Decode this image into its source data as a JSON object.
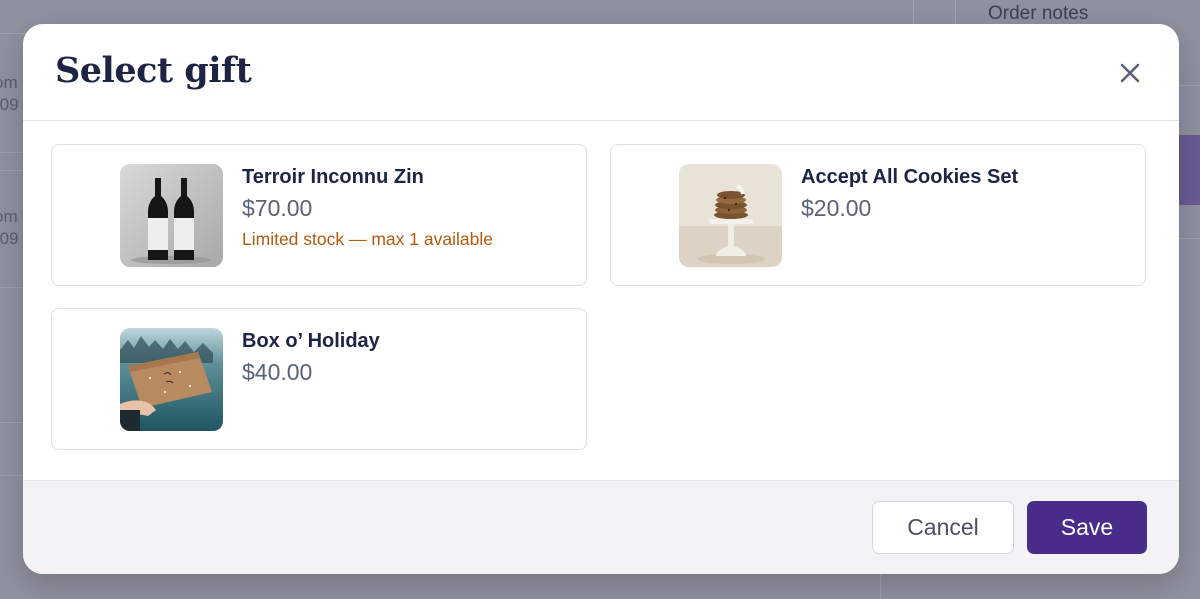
{
  "background": {
    "order_notes_label": "Order notes",
    "edge_text": [
      "om",
      "-09",
      "om",
      "-09"
    ]
  },
  "modal": {
    "title": "Select gift",
    "close_icon": "close-icon",
    "gifts": [
      {
        "name": "Terroir Inconnu Zin",
        "price": "$70.00",
        "note": "Limited stock — max 1 available",
        "image": "wine-bottles"
      },
      {
        "name": "Accept All Cookies Set",
        "price": "$20.00",
        "note": "",
        "image": "cookie-stand"
      },
      {
        "name": "Box o’ Holiday",
        "price": "$40.00",
        "note": "",
        "image": "holiday-box"
      }
    ],
    "footer": {
      "cancel_label": "Cancel",
      "save_label": "Save"
    }
  },
  "colors": {
    "accent": "#4a2d8a",
    "title": "#1d2444",
    "warning": "#b35a10",
    "overlay": "#8e919e"
  }
}
